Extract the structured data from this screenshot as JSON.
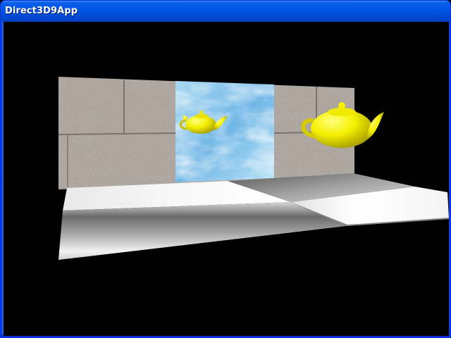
{
  "window": {
    "title": "Direct3D9App"
  },
  "scene": {
    "background_color": "#000000",
    "teapot_color": "#f2f000",
    "objects": [
      "stone-wall",
      "water-mirror-panel",
      "teapot-small",
      "teapot-large",
      "marble-floor"
    ]
  }
}
